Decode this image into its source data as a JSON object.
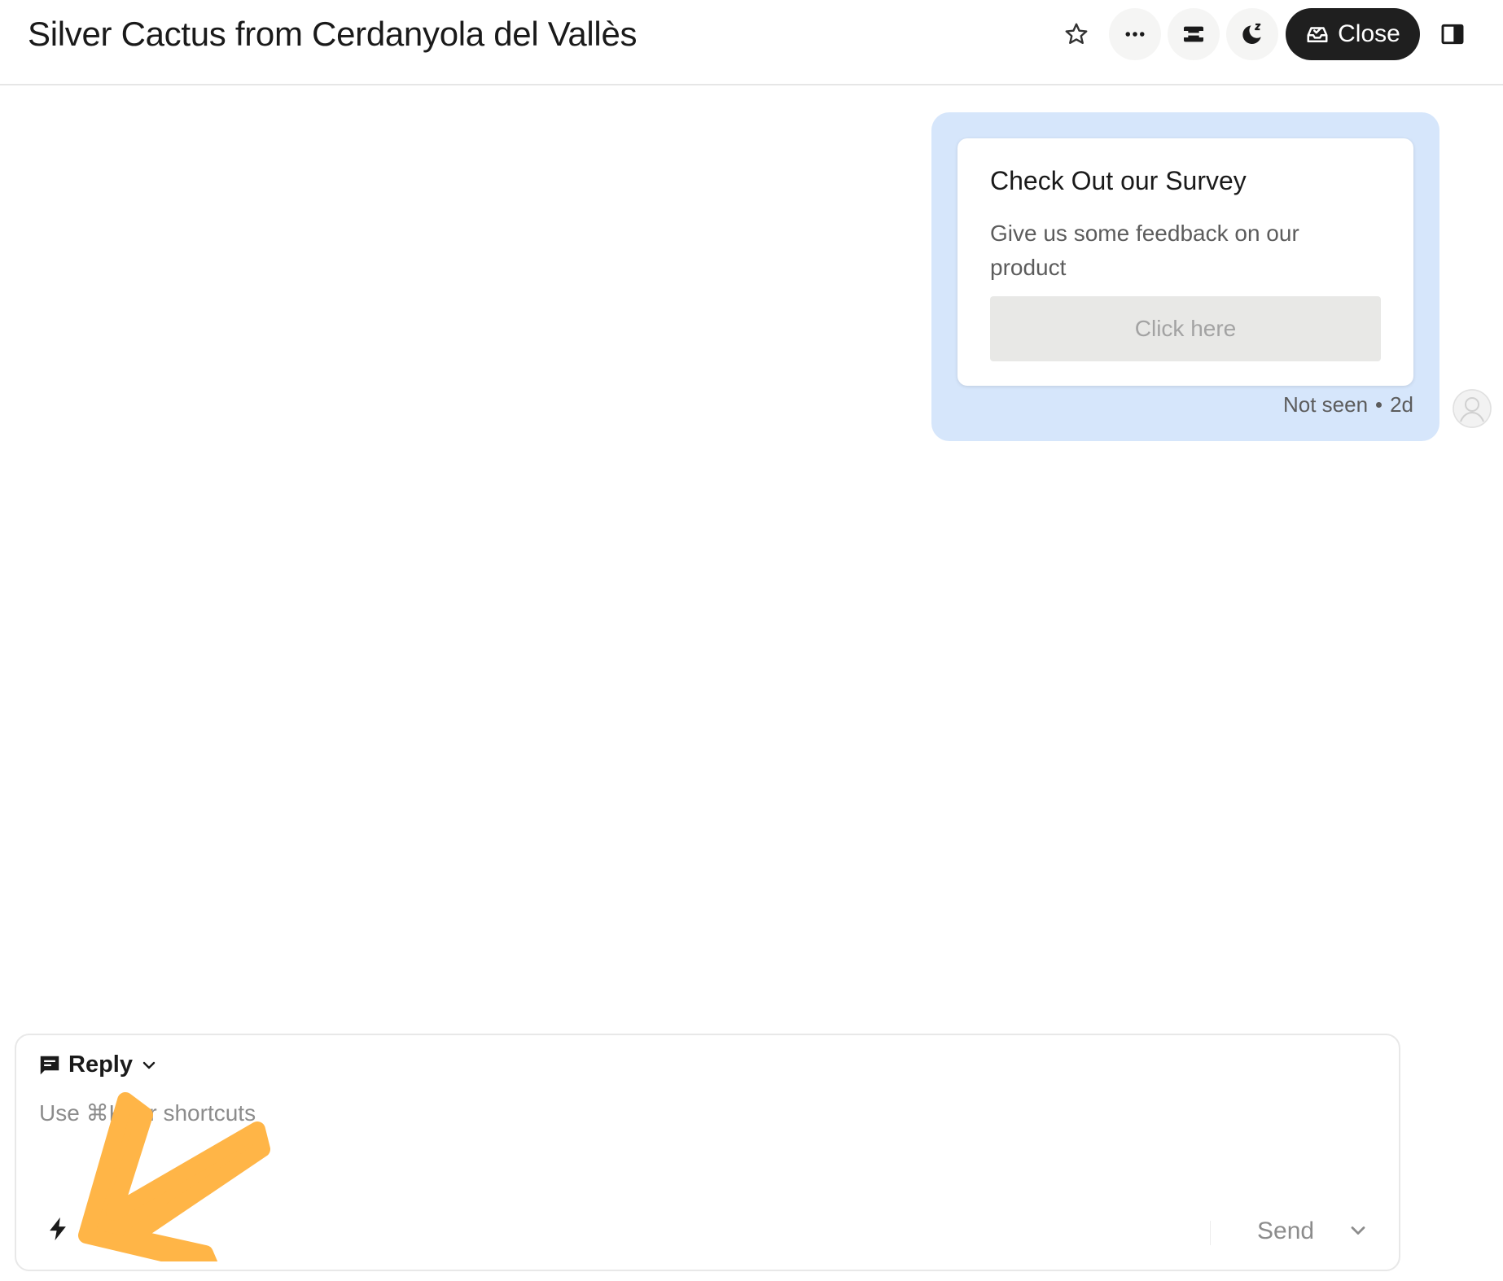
{
  "header": {
    "title": "Silver Cactus from Cerdanyola del Vallès",
    "close_label": "Close",
    "icons": [
      "star-icon",
      "more-icon",
      "inbox-icon",
      "snooze-icon",
      "close-inbox-icon",
      "side-panel-icon"
    ]
  },
  "message": {
    "card_title": "Check Out our Survey",
    "card_description": "Give us some feedback on our product",
    "card_button": "Click here",
    "status": "Not seen",
    "time": "2d",
    "bubble_color": "#d6e6fb"
  },
  "composer": {
    "mode_label": "Reply",
    "placeholder": "Use ⌘K for shortcuts",
    "send_label": "Send"
  },
  "colors": {
    "accent_dark": "#1f1f1f",
    "annotation_arrow": "#ffb547"
  }
}
